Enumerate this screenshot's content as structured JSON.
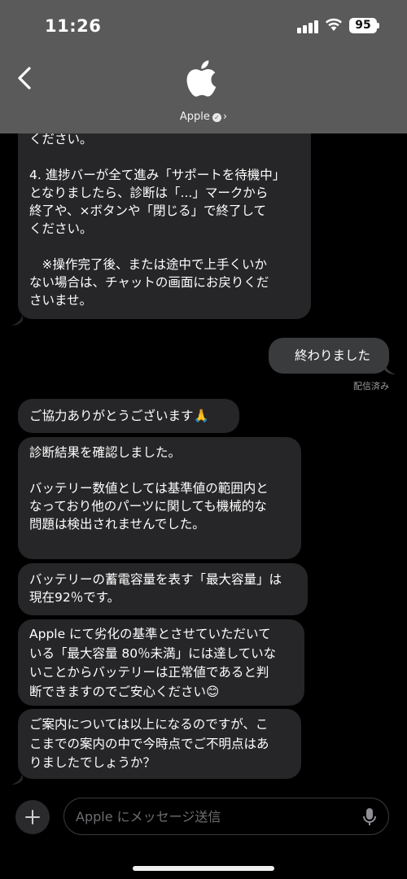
{
  "status": {
    "time": "11:26",
    "battery": "95"
  },
  "header": {
    "contact_name": "Apple",
    "back_icon": "chevron-left-icon",
    "avatar_icon": "apple-logo-icon"
  },
  "messages": [
    {
      "dir": "in",
      "text": "ください。\n\n4. 進捗バーが全て進み「サポートを待機中」\nとなりましたら、診断は「...」マークから\n終了や、×ボタンや「閉じる」で終了して\nください。\n\n　※操作完了後、または途中で上手くいか\nない場合は、チャットの画面にお戻りくだ\nさいませ。"
    },
    {
      "dir": "out",
      "text": "終わりました"
    },
    {
      "dir": "in",
      "text": "ご協力ありがとうございます🙏"
    },
    {
      "dir": "in",
      "text": "診断結果を確認しました。\n\nバッテリー数値としては基準値の範囲内と\nなっており他のパーツに関しても機械的な\n問題は検出されませんでした。"
    },
    {
      "dir": "in",
      "text": "バッテリーの蓄電容量を表す「最大容量」は\n現在92％です。"
    },
    {
      "dir": "in",
      "text": "Apple にて劣化の基準とさせていただいて\nいる「最大容量 80％未満」には達していな\nいことからバッテリーは正常値であると判\n断できますのでご安心ください😊"
    },
    {
      "dir": "in",
      "text": "ご案内については以上になるのですが、こ\nこまでの案内の中で今時点でご不明点はあ\nりましたでしょうか？"
    }
  ],
  "delivered_label": "配信済み",
  "composer": {
    "placeholder": "Apple にメッセージ送信",
    "value": ""
  },
  "colors": {
    "header_bg": "#5a5a5a",
    "bubble_in": "#262628",
    "bubble_out": "#3a3b3d",
    "background": "#000000"
  }
}
